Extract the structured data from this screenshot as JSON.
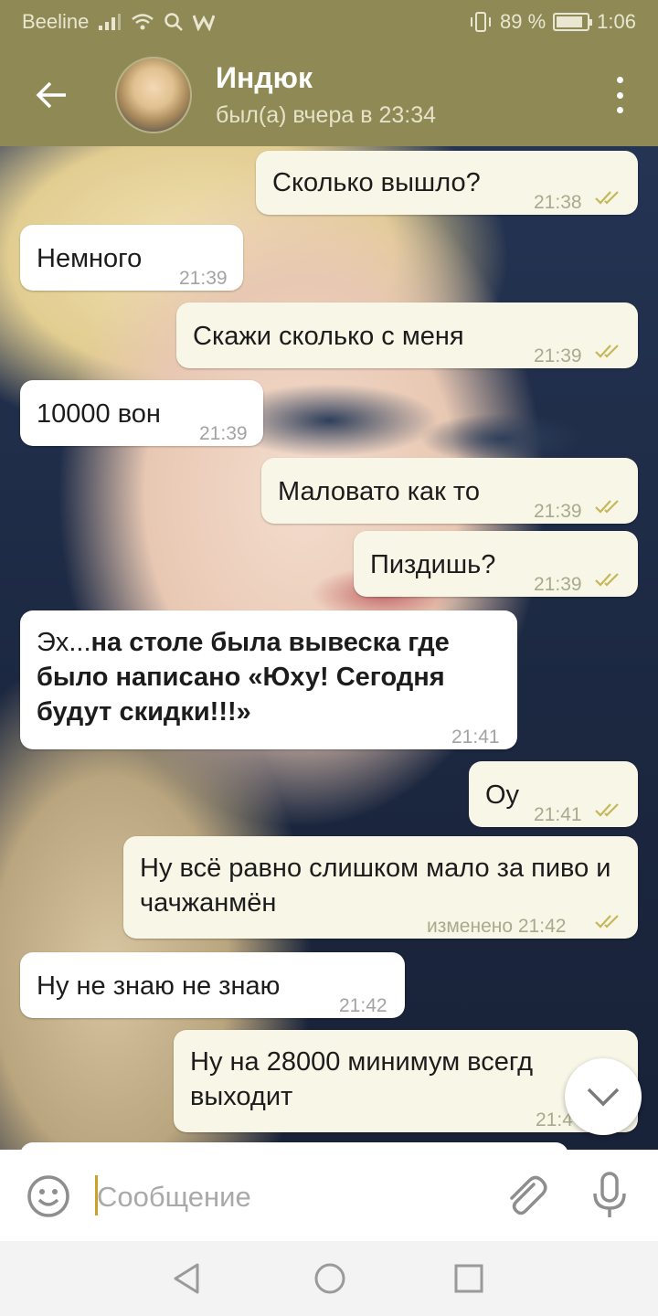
{
  "status_bar": {
    "carrier": "Beeline",
    "battery_percent": "89 %",
    "battery_level": 0.89,
    "time": "1:06"
  },
  "header": {
    "contact_name": "Индюк",
    "last_seen": "был(а) вчера в 23:34"
  },
  "colors": {
    "header": "#8f8a55",
    "outgoing_bubble": "#f8f6e6",
    "incoming_bubble": "#ffffff",
    "ticks": "#c4b85a",
    "caret": "#c9a227"
  },
  "messages": [
    {
      "direction": "out",
      "text": "Сколько вышло?",
      "time": "21:38",
      "read": true
    },
    {
      "direction": "in",
      "text": "Немного",
      "time": "21:39"
    },
    {
      "direction": "out",
      "text": "Скажи сколько с меня",
      "time": "21:39",
      "read": true
    },
    {
      "direction": "in",
      "text": "10000 вон",
      "time": "21:39"
    },
    {
      "direction": "out",
      "text": "Маловато как то",
      "time": "21:39",
      "read": true
    },
    {
      "direction": "out",
      "text": "Пиздишь?",
      "time": "21:39",
      "read": true
    },
    {
      "direction": "in",
      "text_prefix": "Эх...",
      "text_bold": "на столе была вывеска где было написано «Юху! Сегодня будут скидки!!!»",
      "time": "21:41"
    },
    {
      "direction": "out",
      "text": "Оу",
      "time": "21:41",
      "read": true
    },
    {
      "direction": "out",
      "text": "Ну всё равно слишком мало за пиво и чачжанмён",
      "edited_label": "изменено",
      "time": "21:42",
      "read": true
    },
    {
      "direction": "in",
      "text": "Ну не знаю не знаю",
      "time": "21:42"
    },
    {
      "direction": "out",
      "text": "Ну на 28000 минимум всегд выходит",
      "time": "21:4"
    }
  ],
  "input": {
    "placeholder": "Сообщение"
  },
  "icons": {
    "back": "arrow-left-icon",
    "menu": "more-vertical-icon",
    "emoji": "smiley-icon",
    "attach": "paperclip-icon",
    "mic": "microphone-icon",
    "scroll": "chevron-down-icon"
  }
}
